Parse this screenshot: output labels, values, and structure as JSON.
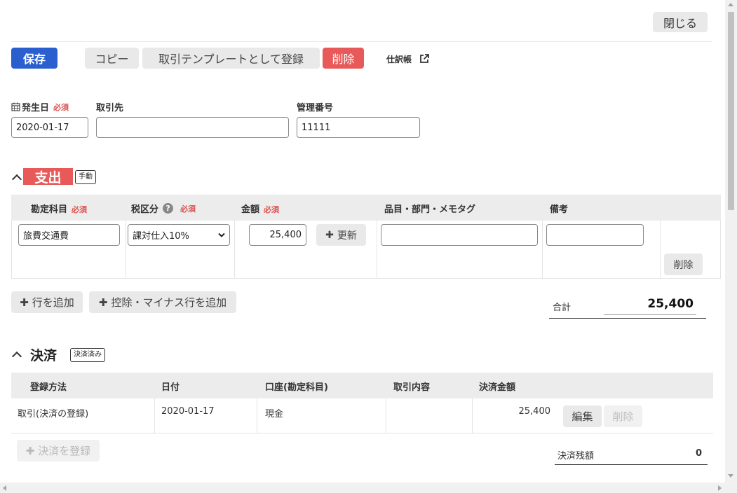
{
  "toolbar": {
    "close_label": "閉じる",
    "save_label": "保存",
    "copy_label": "コピー",
    "register_template_label": "取引テンプレートとして登録",
    "delete_label": "削除",
    "journal_label": "仕訳帳"
  },
  "header_fields": {
    "date_label": "発生日",
    "required": "必須",
    "date_value": "2020-01-17",
    "partner_label": "取引先",
    "partner_value": "",
    "mgmt_label": "管理番号",
    "mgmt_value": "11111"
  },
  "expense": {
    "title": "支出",
    "badge": "手動",
    "columns": {
      "account": "勘定科目",
      "tax": "税区分",
      "amount": "金額",
      "items": "品目・部門・メモタグ",
      "note": "備考"
    },
    "row": {
      "account": "旅費交通費",
      "tax": "課対仕入10%",
      "amount": "25,400",
      "update_label": "更新",
      "items": "",
      "note": "",
      "delete_label": "削除"
    },
    "add_row_label": "行を追加",
    "add_minus_row_label": "控除・マイナス行を追加",
    "total_label": "合計",
    "total_value": "25,400"
  },
  "settlement": {
    "title": "決済",
    "badge": "決済済み",
    "columns": {
      "method": "登録方法",
      "date": "日付",
      "account": "口座(勘定科目)",
      "content": "取引内容",
      "amount": "決済金額"
    },
    "row": {
      "method": "取引(決済の登録)",
      "date": "2020-01-17",
      "account": "現金",
      "content": "",
      "amount": "25,400",
      "edit_label": "編集",
      "delete_label": "削除"
    },
    "register_label": "決済を登録",
    "balance_label": "決済残額",
    "balance_value": "0"
  },
  "colors": {
    "primary": "#2b5fcf",
    "danger": "#e85a5a",
    "required": "#d9534f"
  }
}
